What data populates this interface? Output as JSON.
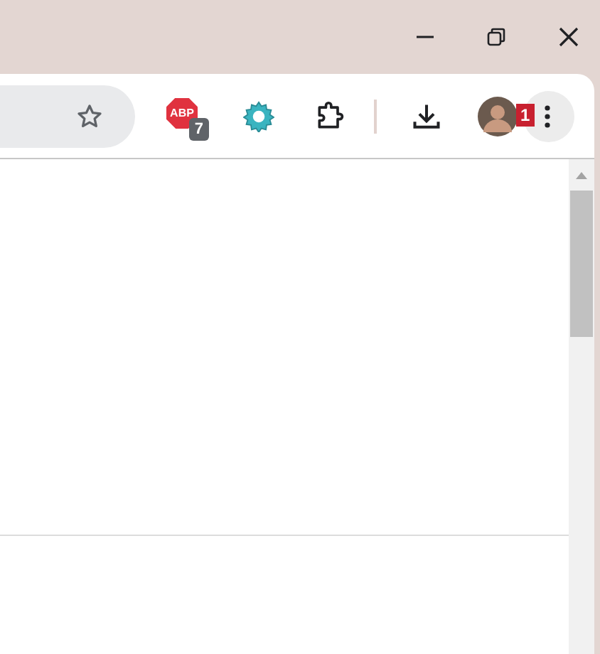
{
  "toolbar": {
    "extensions": [
      {
        "kind": "abp",
        "logo": "ABP",
        "badge": "7"
      },
      {
        "kind": "gear"
      },
      {
        "kind": "puzzle"
      }
    ],
    "callout": "1"
  }
}
